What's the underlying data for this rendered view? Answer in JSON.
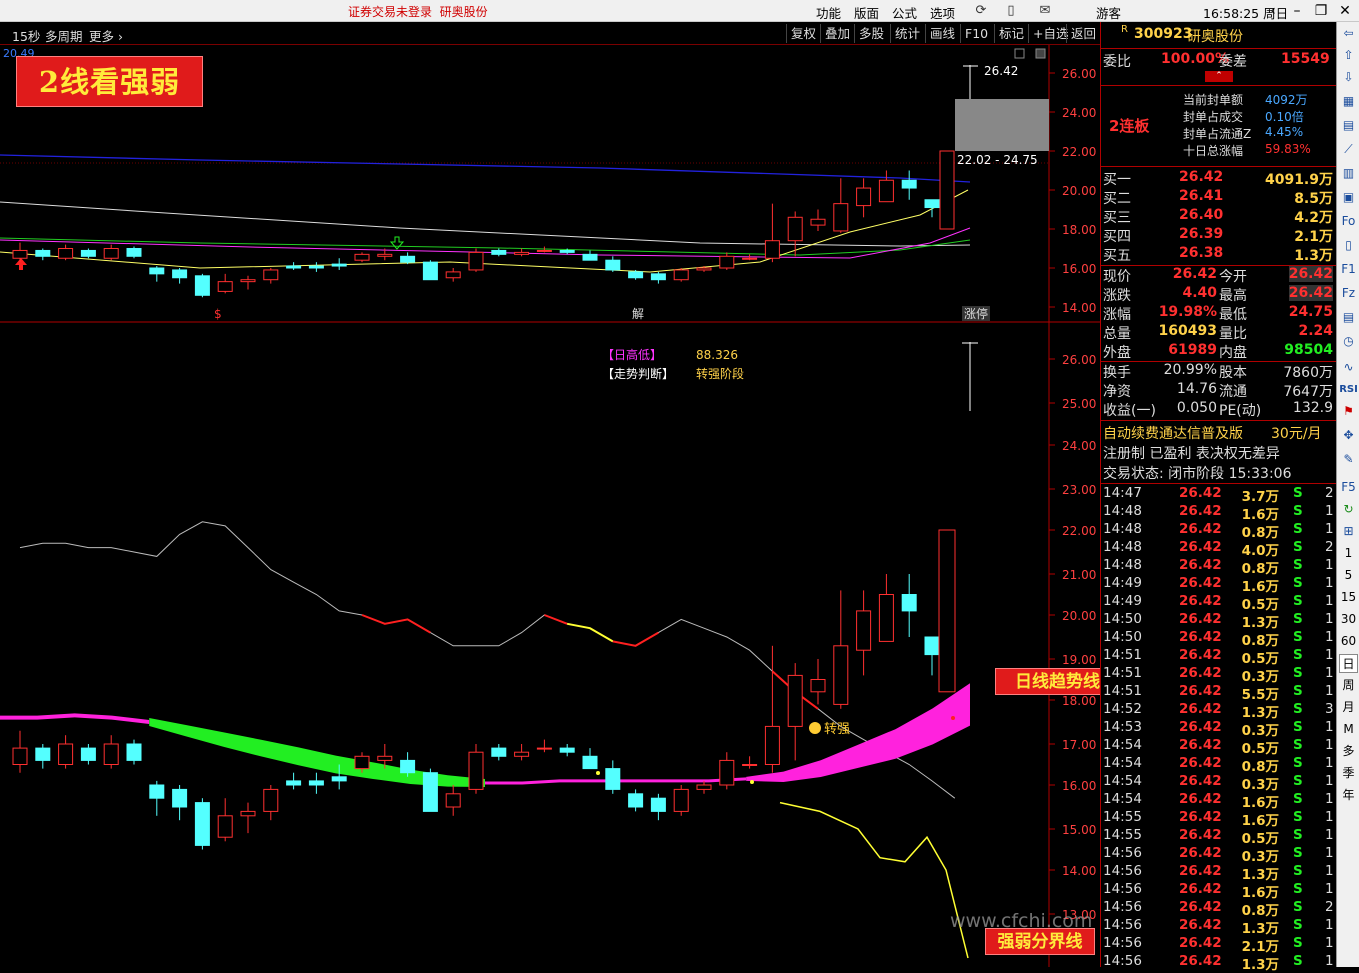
{
  "titlebar": {
    "warning": "证券交易未登录",
    "stock_name": "研奥股份",
    "menus": [
      "功能",
      "版面",
      "公式",
      "选项"
    ],
    "guest": "游客",
    "clock": "16:58:25 周日"
  },
  "toolbar": {
    "period": "15秒",
    "multi_period": "多周期",
    "more": "更多",
    "buttons": [
      "复权",
      "叠加",
      "多股",
      "统计",
      "画线",
      "F10",
      "标记",
      "+自选",
      "返回"
    ]
  },
  "chart": {
    "banner": "2线看强弱",
    "top_left_value": "20.49",
    "max_label": "26.42",
    "range_label": "22.02 - 24.75",
    "upper_axis": [
      "26.00",
      "24.00",
      "22.00",
      "20.00",
      "18.00",
      "16.00",
      "14.00"
    ],
    "lower_axis": [
      "26.00",
      "25.00",
      "24.00",
      "23.00",
      "22.00",
      "21.00",
      "20.00",
      "19.00",
      "18.00",
      "17.00",
      "16.00",
      "15.00",
      "14.00",
      "13.00"
    ],
    "markers": {
      "s": "$",
      "jie": "解",
      "zhangting": "涨停"
    },
    "indicator": {
      "label1": "【日高低】",
      "value1": "88.326",
      "label2": "【走势判断】",
      "value2": "转强阶段"
    },
    "zhuanqiang": "转强",
    "callout_trend": "日线趋势线绿跌红涨",
    "callout_split": "强弱分界线",
    "watermark": "www.cfchi.com",
    "colors": {
      "up": "#ff3030",
      "down": "#54ffff",
      "ribbon_green": "#22ee22",
      "ribbon_pink": "#ff22dd",
      "weak_line": "#ffff33"
    },
    "candles": [
      [
        16.5,
        16.9,
        17.3,
        16.3
      ],
      [
        16.9,
        16.6,
        17.0,
        16.4
      ],
      [
        16.5,
        17.0,
        17.2,
        16.4
      ],
      [
        16.9,
        16.6,
        17.0,
        16.5
      ],
      [
        16.5,
        17.0,
        17.2,
        16.4
      ],
      [
        17.0,
        16.6,
        17.1,
        16.5
      ],
      [
        16.0,
        15.7,
        16.1,
        15.3
      ],
      [
        15.9,
        15.5,
        16.0,
        15.2
      ],
      [
        15.6,
        14.6,
        15.7,
        14.5
      ],
      [
        14.8,
        15.3,
        15.7,
        14.7
      ],
      [
        15.3,
        15.4,
        15.6,
        14.9
      ],
      [
        15.4,
        15.9,
        16.0,
        15.2
      ],
      [
        16.1,
        16.0,
        16.3,
        15.9
      ],
      [
        16.1,
        16.0,
        16.3,
        15.8
      ],
      [
        16.2,
        16.1,
        16.5,
        15.9
      ],
      [
        16.4,
        16.7,
        16.8,
        16.3
      ],
      [
        16.6,
        16.7,
        17.0,
        16.4
      ],
      [
        16.6,
        16.3,
        16.8,
        16.2
      ],
      [
        16.3,
        15.4,
        16.4,
        15.4
      ],
      [
        15.5,
        15.8,
        16.0,
        15.3
      ],
      [
        15.9,
        16.8,
        17.0,
        15.8
      ],
      [
        16.9,
        16.7,
        17.0,
        16.6
      ],
      [
        16.7,
        16.8,
        17.0,
        16.6
      ],
      [
        16.9,
        16.9,
        17.1,
        16.8
      ],
      [
        16.9,
        16.8,
        17.0,
        16.7
      ],
      [
        16.7,
        16.4,
        16.9,
        16.4
      ],
      [
        16.4,
        15.9,
        16.6,
        15.8
      ],
      [
        15.8,
        15.5,
        15.9,
        15.4
      ],
      [
        15.7,
        15.4,
        15.8,
        15.2
      ],
      [
        15.4,
        15.9,
        16.0,
        15.3
      ],
      [
        15.9,
        16.0,
        16.1,
        15.8
      ],
      [
        16.0,
        16.6,
        16.8,
        15.9
      ],
      [
        16.5,
        16.5,
        16.7,
        16.4
      ],
      [
        16.5,
        17.4,
        19.3,
        16.3
      ],
      [
        17.4,
        18.6,
        18.9,
        16.6
      ],
      [
        18.2,
        18.5,
        19.0,
        17.9
      ],
      [
        17.9,
        19.3,
        20.6,
        17.8
      ],
      [
        19.2,
        20.1,
        20.6,
        18.6
      ],
      [
        19.4,
        20.5,
        21.0,
        19.4
      ],
      [
        20.5,
        20.1,
        21.0,
        19.5
      ],
      [
        19.5,
        19.1,
        19.5,
        18.6
      ],
      [
        18.2,
        22.0,
        22.0,
        18.2
      ]
    ],
    "weak_line": [
      15.6,
      15.4,
      15.0,
      14.3,
      14.2,
      14.8,
      14.0,
      12.0
    ],
    "white_line": [
      21.6,
      21.7,
      21.7,
      21.6,
      21.6,
      21.5,
      21.4,
      21.9,
      22.2,
      22.1,
      21.6,
      21.1,
      20.8,
      20.5,
      20.1,
      20.0,
      19.8,
      19.9,
      19.6,
      19.3,
      19.3,
      19.3,
      19.6,
      20.0,
      19.8,
      19.7,
      19.4,
      19.3,
      19.6,
      19.9,
      19.7,
      19.5,
      19.2,
      18.7,
      18.2,
      17.8,
      17.4,
      17.1,
      16.8,
      16.5,
      16.1,
      15.7
    ],
    "ribbon_mid": [
      17.6,
      17.6,
      17.65,
      17.6,
      17.5,
      17.3,
      17.1,
      16.9,
      16.7,
      16.5,
      16.35,
      16.2,
      16.1,
      16.05,
      16.05,
      16.1,
      16.1,
      16.1,
      16.1,
      16.1,
      16.15,
      16.2,
      16.4,
      16.7,
      17.0,
      17.4,
      17.9
    ]
  },
  "right_panel": {
    "code": "300923",
    "name": "研奥股份",
    "weibi_label": "委比",
    "weibi_value": "100.00%",
    "weicha_label": "委差",
    "weicha_value": "15549",
    "lianban": "2连板",
    "fengdan": [
      {
        "label": "当前封单额",
        "value": "4092万"
      },
      {
        "label": "封单占成交",
        "value": "0.10倍"
      },
      {
        "label": "封单占流通Z",
        "value": "4.45%"
      },
      {
        "label": "十日总涨幅",
        "value": "59.83%"
      }
    ],
    "bids": [
      {
        "label": "买一",
        "price": "26.42",
        "vol": "4091.9万"
      },
      {
        "label": "买二",
        "price": "26.41",
        "vol": "8.5万"
      },
      {
        "label": "买三",
        "price": "26.40",
        "vol": "4.2万"
      },
      {
        "label": "买四",
        "price": "26.39",
        "vol": "2.1万"
      },
      {
        "label": "买五",
        "price": "26.38",
        "vol": "1.3万"
      }
    ],
    "quote": [
      {
        "l1": "现价",
        "v1": "26.42",
        "l2": "今开",
        "v2": "26.42"
      },
      {
        "l1": "涨跌",
        "v1": "4.40",
        "l2": "最高",
        "v2": "26.42"
      },
      {
        "l1": "涨幅",
        "v1": "19.98%",
        "l2": "最低",
        "v2": "24.75"
      },
      {
        "l1": "总量",
        "v1": "160493",
        "l2": "量比",
        "v2": "2.24"
      },
      {
        "l1": "外盘",
        "v1": "61989",
        "l2": "内盘",
        "v2": "98504"
      }
    ],
    "fund": [
      {
        "l1": "换手",
        "v1": "20.99%",
        "l2": "股本",
        "v2": "7860万"
      },
      {
        "l1": "净资",
        "v1": "14.76",
        "l2": "流通",
        "v2": "7647万"
      },
      {
        "l1": "收益(一)",
        "v1": "0.050",
        "l2": "PE(动)",
        "v2": "132.9"
      }
    ],
    "promo": "自动续费通达信普及版",
    "promo_price": "30元/月",
    "reg": "注册制 已盈利 表决权无差异",
    "status": "交易状态: 闭市阶段 15:33:06",
    "ticks": [
      [
        "14:47",
        "26.42",
        "3.7万",
        "S",
        "2"
      ],
      [
        "14:48",
        "26.42",
        "1.6万",
        "S",
        "1"
      ],
      [
        "14:48",
        "26.42",
        "0.8万",
        "S",
        "1"
      ],
      [
        "14:48",
        "26.42",
        "4.0万",
        "S",
        "2"
      ],
      [
        "14:48",
        "26.42",
        "0.8万",
        "S",
        "1"
      ],
      [
        "14:49",
        "26.42",
        "1.6万",
        "S",
        "1"
      ],
      [
        "14:49",
        "26.42",
        "0.5万",
        "S",
        "1"
      ],
      [
        "14:50",
        "26.42",
        "1.3万",
        "S",
        "1"
      ],
      [
        "14:50",
        "26.42",
        "0.8万",
        "S",
        "1"
      ],
      [
        "14:51",
        "26.42",
        "0.5万",
        "S",
        "1"
      ],
      [
        "14:51",
        "26.42",
        "0.3万",
        "S",
        "1"
      ],
      [
        "14:51",
        "26.42",
        "5.5万",
        "S",
        "1"
      ],
      [
        "14:52",
        "26.42",
        "1.3万",
        "S",
        "3"
      ],
      [
        "14:53",
        "26.42",
        "0.3万",
        "S",
        "1"
      ],
      [
        "14:54",
        "26.42",
        "0.5万",
        "S",
        "1"
      ],
      [
        "14:54",
        "26.42",
        "0.8万",
        "S",
        "1"
      ],
      [
        "14:54",
        "26.42",
        "0.3万",
        "S",
        "1"
      ],
      [
        "14:54",
        "26.42",
        "1.6万",
        "S",
        "1"
      ],
      [
        "14:55",
        "26.42",
        "1.6万",
        "S",
        "1"
      ],
      [
        "14:55",
        "26.42",
        "0.5万",
        "S",
        "1"
      ],
      [
        "14:56",
        "26.42",
        "0.3万",
        "S",
        "1"
      ],
      [
        "14:56",
        "26.42",
        "1.3万",
        "S",
        "1"
      ],
      [
        "14:56",
        "26.42",
        "1.6万",
        "S",
        "1"
      ],
      [
        "14:56",
        "26.42",
        "0.8万",
        "S",
        "2"
      ],
      [
        "14:56",
        "26.42",
        "1.3万",
        "S",
        "1"
      ],
      [
        "14:56",
        "26.42",
        "2.1万",
        "S",
        "1"
      ],
      [
        "14:56",
        "26.42",
        "1.3万",
        "S",
        "1"
      ]
    ]
  },
  "sidebar": {
    "periods": [
      "1",
      "5",
      "15",
      "30",
      "60",
      "日",
      "周",
      "月",
      "M",
      "多",
      "季",
      "年"
    ]
  }
}
